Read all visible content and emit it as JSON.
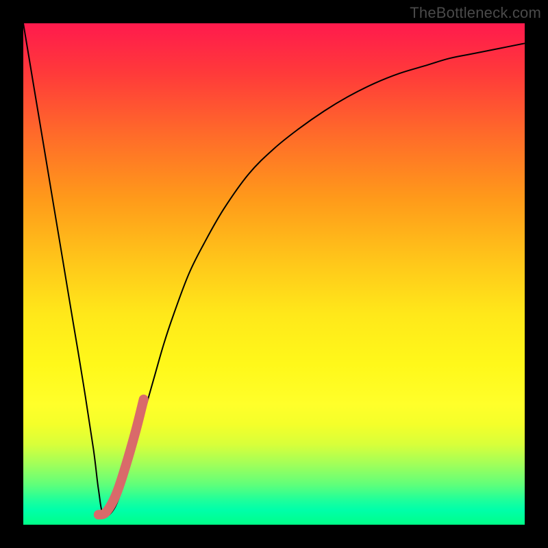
{
  "watermark": "TheBottleneck.com",
  "chart_data": {
    "type": "line",
    "title": "",
    "xlabel": "",
    "ylabel": "",
    "xlim": [
      0,
      100
    ],
    "ylim": [
      0,
      100
    ],
    "grid": false,
    "legend": false,
    "series": [
      {
        "name": "bottleneck-curve",
        "color": "#000000",
        "stroke_width": 2,
        "x": [
          0,
          2,
          4,
          6,
          8,
          10,
          12,
          14,
          15,
          16,
          18,
          20,
          22,
          24,
          26,
          28,
          30,
          33,
          36,
          40,
          45,
          50,
          55,
          60,
          65,
          70,
          75,
          80,
          85,
          90,
          95,
          100
        ],
        "y": [
          100,
          88,
          76,
          64,
          52,
          40,
          28,
          15,
          7,
          2,
          3,
          8,
          15,
          22,
          29,
          36,
          42,
          50,
          56,
          63,
          70,
          75,
          79,
          82.5,
          85.5,
          88,
          90,
          91.5,
          93,
          94,
          95,
          96
        ]
      },
      {
        "name": "highlight-segment",
        "color": "#d96a6a",
        "stroke_width": 14,
        "linecap": "round",
        "x": [
          15,
          16.5,
          18.5,
          20.5,
          22.5,
          24
        ],
        "y": [
          2,
          2.5,
          6,
          12,
          19,
          25
        ]
      }
    ],
    "gradient_stops": [
      {
        "pos": 0.0,
        "color": "#ff1a4d"
      },
      {
        "pos": 0.35,
        "color": "#ff9a1a"
      },
      {
        "pos": 0.68,
        "color": "#fff81a"
      },
      {
        "pos": 0.92,
        "color": "#60ff7a"
      },
      {
        "pos": 1.0,
        "color": "#00ff88"
      }
    ]
  }
}
